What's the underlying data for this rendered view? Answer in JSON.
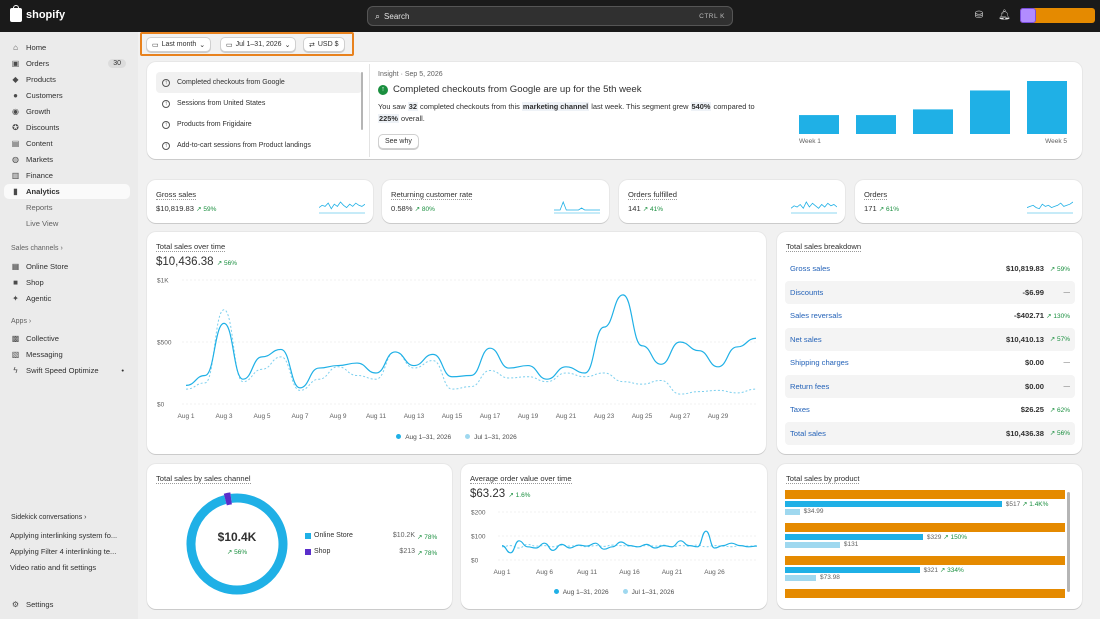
{
  "topbar": {
    "logo": "shopify",
    "search_placeholder": "Search",
    "shortcut": "CTRL  K"
  },
  "sidebar": {
    "items": [
      {
        "label": "Home",
        "icon": "home-icon"
      },
      {
        "label": "Orders",
        "icon": "orders-icon",
        "badge": "30"
      },
      {
        "label": "Products",
        "icon": "tag-icon"
      },
      {
        "label": "Customers",
        "icon": "person-icon"
      },
      {
        "label": "Growth",
        "icon": "growth-icon"
      },
      {
        "label": "Discounts",
        "icon": "discount-icon"
      },
      {
        "label": "Content",
        "icon": "content-icon"
      },
      {
        "label": "Markets",
        "icon": "globe-icon"
      },
      {
        "label": "Finance",
        "icon": "bank-icon"
      },
      {
        "label": "Analytics",
        "icon": "chart-icon"
      },
      {
        "label": "Reports"
      },
      {
        "label": "Live View"
      }
    ],
    "sales_channels_label": "Sales channels",
    "channels": [
      {
        "label": "Online Store"
      },
      {
        "label": "Shop"
      },
      {
        "label": "Agentic"
      }
    ],
    "apps_label": "Apps",
    "apps": [
      {
        "label": "Collective"
      },
      {
        "label": "Messaging"
      },
      {
        "label": "Swift Speed Optimize"
      }
    ],
    "sidekick_label": "Sidekick conversations",
    "conversations": [
      "Applying interlinking system fo...",
      "Applying Filter 4 interlinking te...",
      "Video ratio and fit settings"
    ],
    "settings": "Settings"
  },
  "filters": {
    "period": "Last month",
    "range": "Jul 1–31, 2026",
    "currency": "USD $"
  },
  "insights": {
    "list": [
      "Completed checkouts from Google",
      "Sessions from United States",
      "Products from Frigidaire",
      "Add-to-cart sessions from Product landings"
    ],
    "meta": "Insight · Sep 5, 2026",
    "headline": "Completed checkouts from Google are up for the 5th week",
    "body_1": "You saw ",
    "count": "32",
    "body_2": " completed checkouts from this ",
    "channel": "marketing channel",
    "body_3": " last week. This segment grew ",
    "pct1": "540%",
    "body_4": " compared to",
    "pct2": "225%",
    "body_5": " overall.",
    "button": "See why",
    "week_first": "Week 1",
    "week_last": "Week 5",
    "weeks": [
      10,
      10,
      13,
      23,
      28
    ]
  },
  "kpis": [
    {
      "title": "Gross sales",
      "value": "$10,819.83",
      "change": "↗ 59%"
    },
    {
      "title": "Returning customer rate",
      "value": "0.58%",
      "change": "↗ 80%"
    },
    {
      "title": "Orders fulfilled",
      "value": "141",
      "change": "↗ 41%"
    },
    {
      "title": "Orders",
      "value": "171",
      "change": "↗ 61%"
    }
  ],
  "total_sales": {
    "title": "Total sales over time",
    "value": "$10,436.38",
    "change": "↗ 56%",
    "legend": [
      "Aug 1–31, 2026",
      "Jul 1–31, 2026"
    ]
  },
  "breakdown": {
    "title": "Total sales breakdown",
    "rows": [
      {
        "label": "Gross sales",
        "value": "$10,819.83",
        "change": "↗ 59%"
      },
      {
        "label": "Discounts",
        "value": "-$6.99",
        "change": "—"
      },
      {
        "label": "Sales reversals",
        "value": "-$402.71",
        "change": "↗ 130%"
      },
      {
        "label": "Net sales",
        "value": "$10,410.13",
        "change": "↗ 57%"
      },
      {
        "label": "Shipping charges",
        "value": "$0.00",
        "change": "—"
      },
      {
        "label": "Return fees",
        "value": "$0.00",
        "change": "—"
      },
      {
        "label": "Taxes",
        "value": "$26.25",
        "change": "↗ 62%"
      },
      {
        "label": "Total sales",
        "value": "$10,436.38",
        "change": "↗ 56%"
      }
    ]
  },
  "channels_card": {
    "title": "Total sales by sales channel",
    "center": "$10.4K",
    "center_change": "↗ 56%",
    "rows": [
      {
        "label": "Online Store",
        "value": "$10.2K",
        "change": "↗ 78%",
        "color": "#1fb0e6"
      },
      {
        "label": "Shop",
        "value": "$213",
        "change": "↗ 78%",
        "color": "#5a2ecb"
      }
    ]
  },
  "aov": {
    "title": "Average order value over time",
    "value": "$63.23",
    "change": "↗ 1.6%",
    "legend": [
      "Aug 1–31, 2026",
      "Jul 1–31, 2026"
    ]
  },
  "products": {
    "title": "Total sales by product",
    "rows": [
      {
        "current": "$517",
        "change": "↗ 1.4K%",
        "previous": "$34.99"
      },
      {
        "current": "$329",
        "change": "↗ 150%",
        "previous": "$131"
      },
      {
        "current": "$321",
        "change": "↗ 334%",
        "previous": "$73.98"
      }
    ]
  },
  "chart_data": [
    {
      "type": "line",
      "title": "Total sales over time",
      "ylabel": "",
      "xlabel": "",
      "ylim": [
        0,
        1000
      ],
      "x": [
        "Aug 1",
        "Aug 2",
        "Aug 3",
        "Aug 4",
        "Aug 5",
        "Aug 6",
        "Aug 7",
        "Aug 8",
        "Aug 9",
        "Aug 10",
        "Aug 11",
        "Aug 12",
        "Aug 13",
        "Aug 14",
        "Aug 15",
        "Aug 16",
        "Aug 17",
        "Aug 18",
        "Aug 19",
        "Aug 20",
        "Aug 21",
        "Aug 22",
        "Aug 23",
        "Aug 24",
        "Aug 25",
        "Aug 26",
        "Aug 27",
        "Aug 28",
        "Aug 29",
        "Aug 30",
        "Aug 31"
      ],
      "x_ticks": [
        "Aug 1",
        "Aug 3",
        "Aug 5",
        "Aug 7",
        "Aug 9",
        "Aug 11",
        "Aug 13",
        "Aug 15",
        "Aug 17",
        "Aug 19",
        "Aug 21",
        "Aug 23",
        "Aug 25",
        "Aug 27",
        "Aug 29"
      ],
      "y_ticks": [
        "$0",
        "$500",
        "$1K"
      ],
      "series": [
        {
          "name": "Aug 1–31, 2026",
          "values": [
            150,
            230,
            650,
            200,
            380,
            440,
            130,
            290,
            310,
            330,
            250,
            420,
            310,
            400,
            220,
            230,
            450,
            290,
            310,
            200,
            300,
            250,
            620,
            880,
            470,
            320,
            500,
            430,
            300,
            460,
            530
          ]
        },
        {
          "name": "Jul 1–31, 2026",
          "values": [
            120,
            170,
            760,
            180,
            280,
            380,
            110,
            200,
            300,
            230,
            200,
            420,
            290,
            350,
            120,
            140,
            270,
            210,
            220,
            180,
            250,
            220,
            250,
            180,
            160,
            190,
            80,
            100,
            110,
            90,
            120
          ]
        }
      ]
    },
    {
      "type": "pie",
      "title": "Total sales by sales channel",
      "categories": [
        "Online Store",
        "Shop"
      ],
      "values": [
        10200,
        213
      ]
    },
    {
      "type": "line",
      "title": "Average order value over time",
      "ylim": [
        0,
        200
      ],
      "x_ticks": [
        "Aug 1",
        "Aug 6",
        "Aug 11",
        "Aug 16",
        "Aug 21",
        "Aug 26"
      ],
      "y_ticks": [
        "$0",
        "$100",
        "$200"
      ],
      "series": [
        {
          "name": "Aug 1–31, 2026",
          "values": [
            60,
            30,
            80,
            55,
            50,
            70,
            40,
            65,
            50,
            62,
            58,
            70,
            45,
            55,
            75,
            60,
            55,
            65,
            50,
            60,
            55,
            80,
            60,
            55,
            120,
            50,
            60,
            70,
            60,
            55,
            58
          ]
        },
        {
          "name": "Jul 1–31, 2026",
          "values": [
            55,
            60,
            50,
            65,
            58,
            60,
            55,
            62,
            58,
            60,
            55,
            60,
            57,
            62,
            60,
            58,
            55,
            60,
            58,
            62,
            55,
            60,
            58,
            62,
            55,
            60,
            58,
            55,
            60,
            58,
            60
          ]
        }
      ]
    },
    {
      "type": "bar",
      "title": "Total sales by product",
      "series": [
        {
          "name": "Aug 1–31, 2026",
          "values": [
            517,
            329,
            321
          ]
        },
        {
          "name": "Jul 1–31, 2026",
          "values": [
            34.99,
            131,
            73.98
          ]
        }
      ]
    }
  ]
}
